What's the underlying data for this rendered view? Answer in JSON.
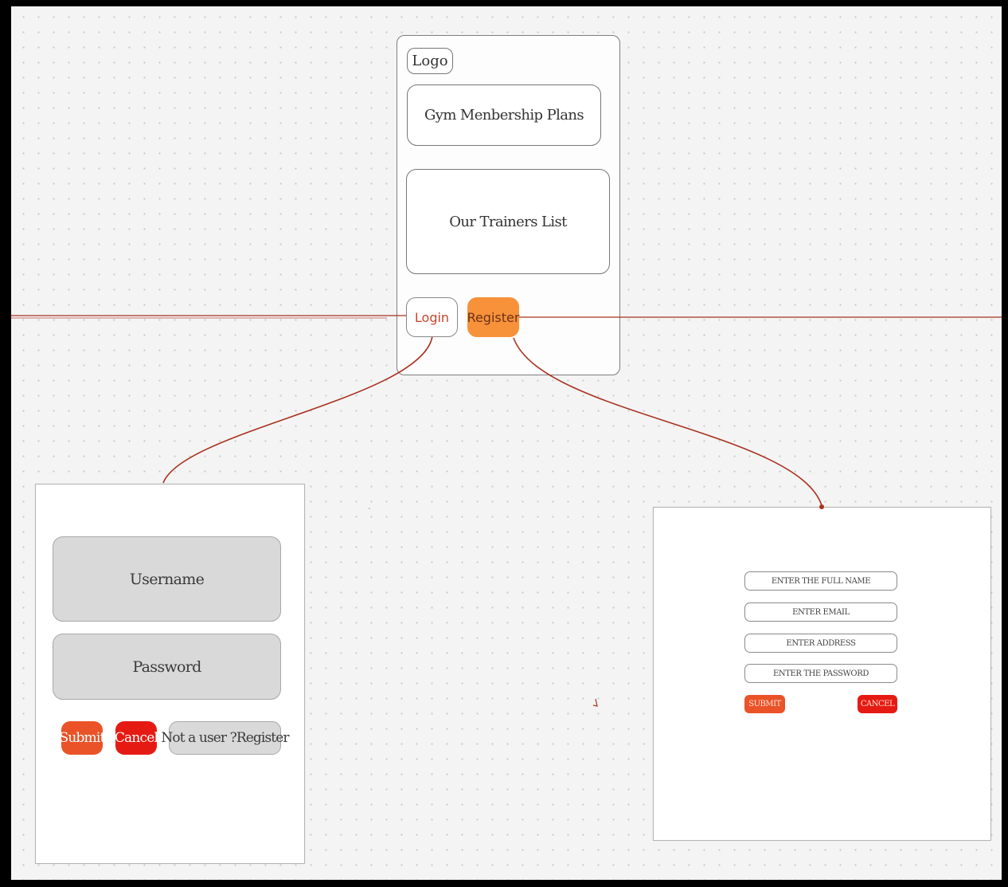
{
  "home_screen": {
    "logo_label": "Logo",
    "membership_plans_label": "Gym Menbership Plans",
    "trainers_list_label": "Our Trainers List",
    "login_label": "Login",
    "register_label": "Register"
  },
  "login_screen": {
    "username_label": "Username",
    "password_label": "Password",
    "submit_label": "Submit",
    "cancel_label": "Cancel",
    "register_link_label": "Not a user ?Register"
  },
  "register_screen": {
    "full_name_placeholder": "ENTER THE FULL NAME",
    "email_placeholder": "ENTER EMAIL",
    "address_placeholder": "ENTER ADDRESS",
    "password_placeholder": "ENTER THE PASSWORD",
    "submit_label": "SUBMIT",
    "cancel_label": "CANCEL"
  },
  "colors": {
    "canvas_background": "#f4f4f4",
    "connector_line": "#a83220",
    "register_button": "#f7923a",
    "submit_button": "#ea5328",
    "cancel_button": "#e51b13",
    "login_field_fill": "#d9d9d9"
  }
}
